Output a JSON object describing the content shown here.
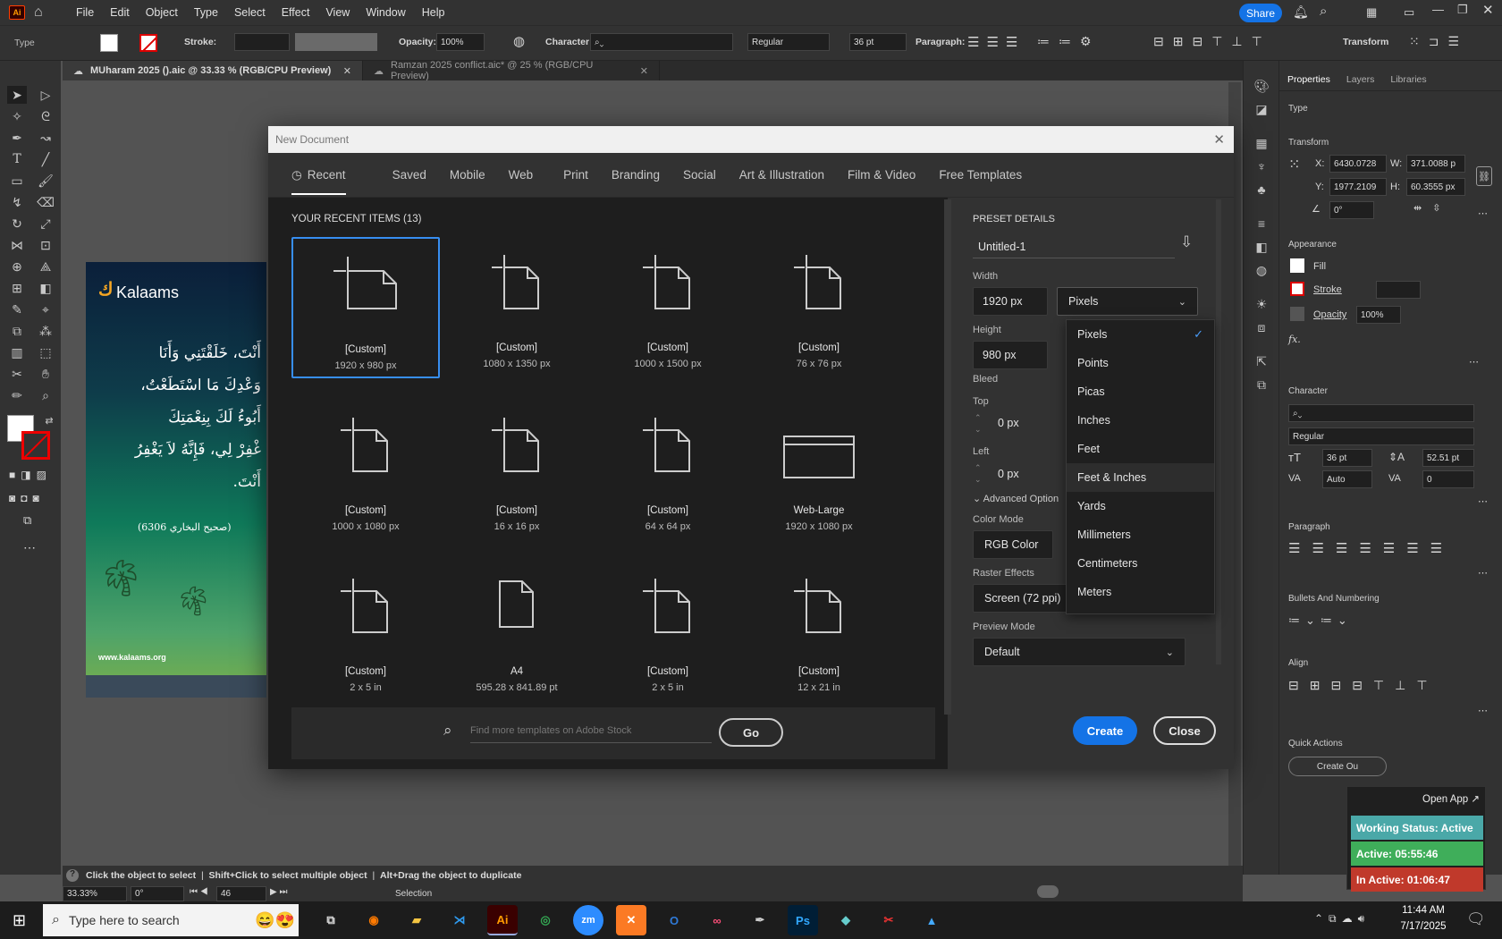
{
  "menubar": {
    "app_icon": "Ai",
    "items": [
      "File",
      "Edit",
      "Object",
      "Type",
      "Select",
      "Effect",
      "View",
      "Window",
      "Help"
    ],
    "share_label": "Share"
  },
  "control_bar": {
    "type_label": "Type",
    "stroke_label": "Stroke:",
    "opacity_label": "Opacity:",
    "opacity_value": "100%",
    "character_label": "Character:",
    "font_style": "Regular",
    "font_size": "36 pt",
    "paragraph_label": "Paragraph:",
    "transform_label": "Transform"
  },
  "doc_tabs": [
    {
      "label": "MUharam 2025 ().aic @ 33.33 % (RGB/CPU Preview)"
    },
    {
      "label": "Ramzan 2025 conflict.aic* @ 25 % (RGB/CPU Preview)"
    }
  ],
  "artboard": {
    "brand": "Kalaams",
    "lines": [
      "أَنْتَ، خَلَقْتَنِي وَأَنَا",
      "وَعْدِكَ مَا اسْتَطَعْتُ،",
      "أَبُوءُ لَكَ بِنِعْمَتِكَ",
      "غْفِرْ لِي، فَإِنَّهُ لاَ يَغْفِرُ",
      "أَنْتَ."
    ],
    "ref": "(صحيح البخاري 6306)",
    "url": "www.kalaams.org"
  },
  "dialog": {
    "title": "New Document",
    "tabs": [
      "Recent",
      "Saved",
      "Mobile",
      "Web",
      "Print",
      "Branding",
      "Social",
      "Art & Illustration",
      "Film & Video",
      "Free Templates"
    ],
    "recent_heading": "YOUR RECENT ITEMS",
    "recent_count": "(13)",
    "items": [
      {
        "name": "[Custom]",
        "size": "1920 x 980 px"
      },
      {
        "name": "[Custom]",
        "size": "1080 x 1350 px"
      },
      {
        "name": "[Custom]",
        "size": "1000 x 1500 px"
      },
      {
        "name": "[Custom]",
        "size": "76 x 76 px"
      },
      {
        "name": "[Custom]",
        "size": "1000 x 1080 px"
      },
      {
        "name": "[Custom]",
        "size": "16 x 16 px"
      },
      {
        "name": "[Custom]",
        "size": "64 x 64 px"
      },
      {
        "name": "Web-Large",
        "size": "1920 x 1080 px"
      },
      {
        "name": "[Custom]",
        "size": "2 x 5 in"
      },
      {
        "name": "A4",
        "size": "595.28 x 841.89 pt"
      },
      {
        "name": "[Custom]",
        "size": "2 x 5 in"
      },
      {
        "name": "[Custom]",
        "size": "12 x 21 in"
      }
    ],
    "search_placeholder": "Find more templates on Adobe Stock",
    "go_label": "Go",
    "preset": {
      "heading": "PRESET DETAILS",
      "name": "Untitled-1",
      "width_label": "Width",
      "width": "1920 px",
      "unit": "Pixels",
      "height_label": "Height",
      "height": "980 px",
      "bleed_label": "Bleed",
      "top_label": "Top",
      "top": "0 px",
      "left_label": "Left",
      "left": "0 px",
      "advanced_label": "Advanced Option",
      "color_mode_label": "Color Mode",
      "color_mode": "RGB Color",
      "raster_label": "Raster Effects",
      "raster": "Screen (72 ppi)",
      "preview_label": "Preview Mode",
      "preview": "Default"
    },
    "unit_options": [
      "Pixels",
      "Points",
      "Picas",
      "Inches",
      "Feet",
      "Feet & Inches",
      "Yards",
      "Millimeters",
      "Centimeters",
      "Meters"
    ],
    "create_label": "Create",
    "close_label": "Close"
  },
  "right_panel": {
    "tabs": [
      "Properties",
      "Layers",
      "Libraries"
    ],
    "type_heading": "Type",
    "transform_heading": "Transform",
    "x_label": "X:",
    "x": "6430.0728",
    "y_label": "Y:",
    "y": "1977.2109",
    "w_label": "W:",
    "w": "371.0088 p",
    "h_label": "H:",
    "h": "60.3555 px",
    "angle": "0°",
    "appearance_heading": "Appearance",
    "fill_label": "Fill",
    "stroke_label": "Stroke",
    "opacity_label": "Opacity",
    "opacity": "100%",
    "fx": "fx.",
    "character_heading": "Character",
    "font_style": "Regular",
    "font_size": "36 pt",
    "leading": "52.51 pt",
    "kerning": "Auto",
    "tracking": "0",
    "paragraph_heading": "Paragraph",
    "bullets_heading": "Bullets And Numbering",
    "align_heading": "Align",
    "quick_heading": "Quick Actions",
    "quick_btn": "Create Ou"
  },
  "status": {
    "hint_1": "Click the object to select",
    "hint_2": "Shift+Click to select multiple object",
    "hint_3": "Alt+Drag the object to duplicate",
    "zoom": "33.33%",
    "rotate": "0°",
    "artboard_num": "46",
    "mode": "Selection"
  },
  "widget": {
    "open_app": "Open App ↗",
    "status": "Working Status: Active",
    "active": "Active: 05:55:46",
    "inactive": "In Active: 01:06:47"
  },
  "taskbar": {
    "search": "Type here to search",
    "time": "11:44 AM",
    "date": "7/17/2025"
  },
  "colors": {
    "accent": "#378ef0",
    "create": "#1473e6",
    "share": "#1473e6",
    "status_green": "#3fae5a",
    "status_red": "#c0392b",
    "status_teal": "#4aa8a8"
  }
}
